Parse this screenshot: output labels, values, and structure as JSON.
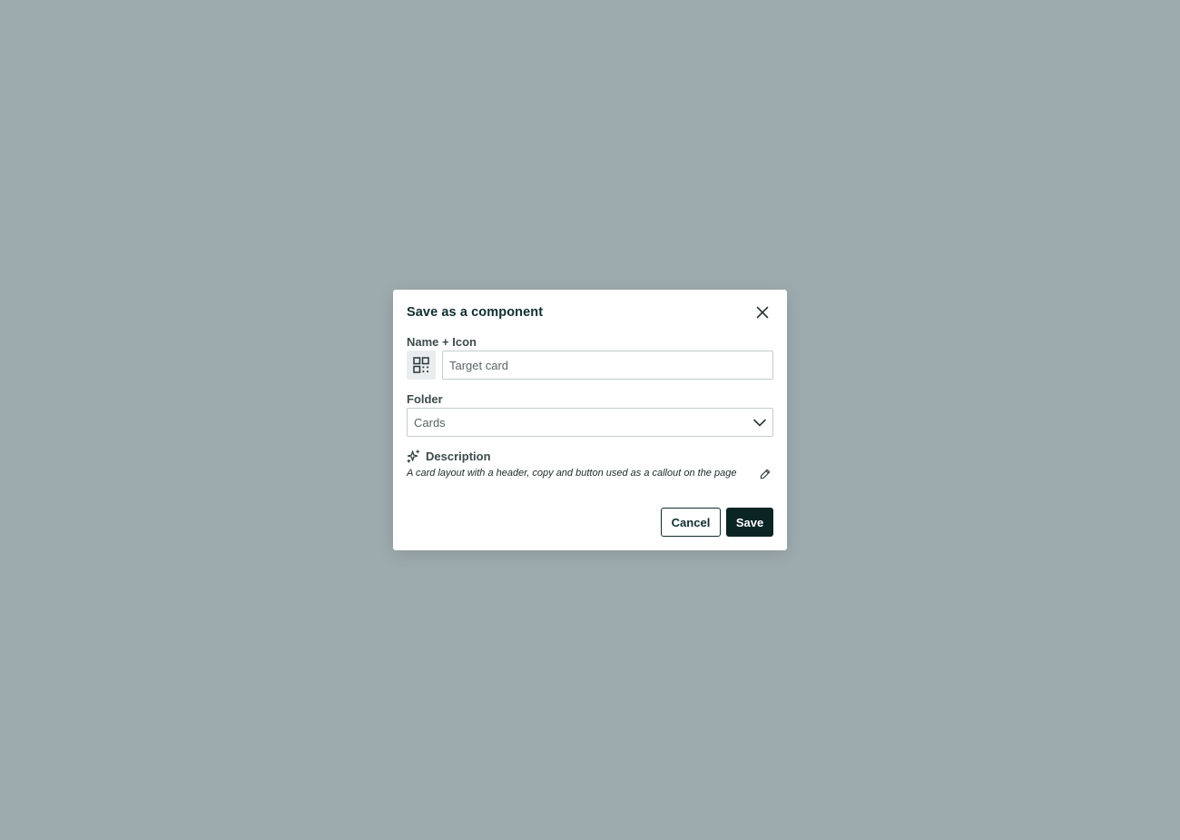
{
  "colors": {
    "backdrop": "#9eabae",
    "primary": "#0b2424",
    "text_dark": "#0f2e2e",
    "border": "#c4cccd"
  },
  "dialog": {
    "title": "Save as a component",
    "close_icon": "close-icon",
    "name_field": {
      "label": "Name + Icon",
      "icon": "component-grid-icon",
      "value": "Target card",
      "placeholder": ""
    },
    "folder_field": {
      "label": "Folder",
      "selected": "Cards",
      "icon": "chevron-down-icon"
    },
    "description": {
      "label": "Description",
      "icon": "sparkle-icon",
      "text": "A card layout with a header, copy and button used as a callout on the page",
      "edit_icon": "pencil-icon"
    },
    "buttons": {
      "cancel": "Cancel",
      "save": "Save"
    }
  }
}
